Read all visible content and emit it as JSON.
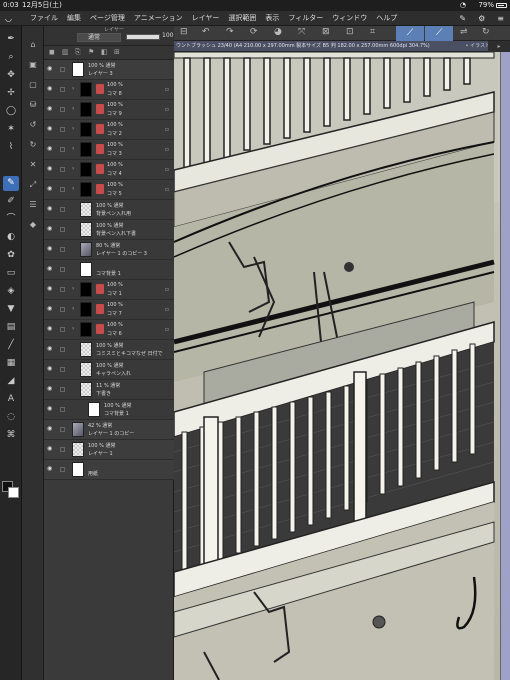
{
  "status": {
    "time": "0:03",
    "date": "12月5日(土)",
    "battery": "79%"
  },
  "menu": [
    "ファイル",
    "編集",
    "ページ管理",
    "アニメーション",
    "レイヤー",
    "選択範囲",
    "表示",
    "フィルター",
    "ウィンドウ",
    "ヘルプ"
  ],
  "layer_panel": {
    "header_label": "レイヤー",
    "blend_mode": "通常",
    "opacity": "100"
  },
  "document": {
    "tab_title": "ウントブラッシュ 23/40 (A4 210.00 x 297.00mm 製本サイズ B5 判 182.00 x 257.00mm 600dpi 304.7%)",
    "tab2": "• イラスト"
  },
  "layers": [
    {
      "l1": "100 % 通常",
      "l2": "レイヤー 3",
      "thumb": "white",
      "indent": 0
    },
    {
      "l1": "100 %",
      "l2": "コマ 8",
      "thumb": "dark",
      "indent": 1,
      "folder": true
    },
    {
      "l1": "100 %",
      "l2": "コマ 9",
      "thumb": "dark",
      "indent": 1,
      "folder": true
    },
    {
      "l1": "100 %",
      "l2": "コマ 2",
      "thumb": "dark",
      "indent": 1,
      "folder": true
    },
    {
      "l1": "100 %",
      "l2": "コマ 3",
      "thumb": "dark",
      "indent": 1,
      "folder": true
    },
    {
      "l1": "100 %",
      "l2": "コマ 4",
      "thumb": "dark",
      "indent": 1,
      "folder": true
    },
    {
      "l1": "100 %",
      "l2": "コマ 5",
      "thumb": "dark",
      "indent": 1,
      "folder": true
    },
    {
      "l1": "100 % 通常",
      "l2": "背景ペン入れ用",
      "thumb": "checker",
      "indent": 1,
      "selected": true
    },
    {
      "l1": "100 % 通常",
      "l2": "背景ペン入れ下書",
      "thumb": "checker",
      "indent": 1
    },
    {
      "l1": "80 % 通常",
      "l2": "レイヤー 1 のコピー 3",
      "thumb": "photo",
      "indent": 1
    },
    {
      "l1": "",
      "l2": "コマ背景 1",
      "thumb": "white",
      "indent": 1
    },
    {
      "l1": "100 %",
      "l2": "コマ 1",
      "thumb": "dark",
      "indent": 1,
      "folder": true
    },
    {
      "l1": "100 %",
      "l2": "コマ 7",
      "thumb": "dark",
      "indent": 1,
      "folder": true
    },
    {
      "l1": "100 %",
      "l2": "コマ 6",
      "thumb": "dark",
      "indent": 1,
      "folder": true
    },
    {
      "l1": "100 % 通常",
      "l2": "コミスミとキコマなぜ 日付で",
      "thumb": "checker",
      "indent": 1
    },
    {
      "l1": "100 % 通常",
      "l2": "キャラペン入れ",
      "thumb": "checker",
      "indent": 1
    },
    {
      "l1": "11 % 通常",
      "l2": "下書き",
      "thumb": "checker",
      "indent": 1
    },
    {
      "l1": "100 % 通常",
      "l2": "コマ背景 1",
      "thumb": "white",
      "indent": 2
    },
    {
      "l1": "42 % 通常",
      "l2": "レイヤー 1 のコピー",
      "thumb": "photo",
      "indent": 0
    },
    {
      "l1": "100 % 通常",
      "l2": "レイヤー 1",
      "thumb": "checker",
      "indent": 0
    },
    {
      "l1": "",
      "l2": "用紙",
      "thumb": "white",
      "indent": 0
    }
  ],
  "tools": [
    "pen-icon",
    "magnify-icon",
    "move-icon",
    "move-layer-icon",
    "lasso-icon",
    "wand-icon",
    "eyedropper-icon",
    "pen-active-icon",
    "pencil-icon",
    "brush-icon",
    "airbrush-icon",
    "decoration-icon",
    "eraser-icon",
    "blend-icon",
    "fill-icon",
    "gradient-icon",
    "figure-icon",
    "frame-icon",
    "ruler-icon",
    "text-icon",
    "balloon-icon",
    "correction-icon"
  ],
  "colors": {
    "accent": "#3d6fb8",
    "selected_row": "#5b6486",
    "scrollbar": "#9fa1c7"
  }
}
